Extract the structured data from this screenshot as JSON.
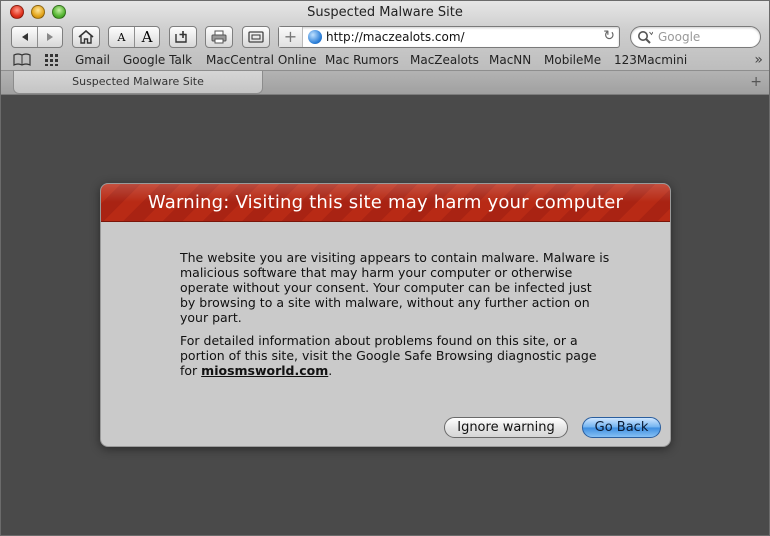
{
  "window": {
    "title": "Suspected Malware Site"
  },
  "toolbar": {
    "font_smaller": "A",
    "font_larger": "A",
    "url": "http://maczealots.com/",
    "search_placeholder": "Google"
  },
  "bookmarks": {
    "items": [
      {
        "label": "Gmail"
      },
      {
        "label": "Google Talk"
      },
      {
        "label": "MacCentral Online"
      },
      {
        "label": "Mac Rumors"
      },
      {
        "label": "MacZealots"
      },
      {
        "label": "MacNN"
      },
      {
        "label": "MobileMe"
      },
      {
        "label": "123Macmini"
      }
    ]
  },
  "tabs": {
    "active_label": "Suspected Malware Site"
  },
  "dialog": {
    "title": "Warning: Visiting this site may harm your computer",
    "paragraph1": "The website you are visiting appears to contain malware. Malware is malicious software that may harm your computer or otherwise operate without your consent. Your computer can be infected just by browsing to a site with malware, without any further action on your part.",
    "paragraph2_prefix": "For detailed information about problems found on this site, or a portion of this site, visit the Google Safe Browsing diagnostic page for ",
    "site_link": "miosmsworld.com",
    "paragraph2_suffix": ".",
    "ignore_label": "Ignore warning",
    "back_label": "Go Back"
  },
  "colors": {
    "header_red": "#b82a15",
    "page_background": "#4a4a4a",
    "dialog_background": "#cacaca",
    "default_button_blue": "#3d8de0"
  }
}
